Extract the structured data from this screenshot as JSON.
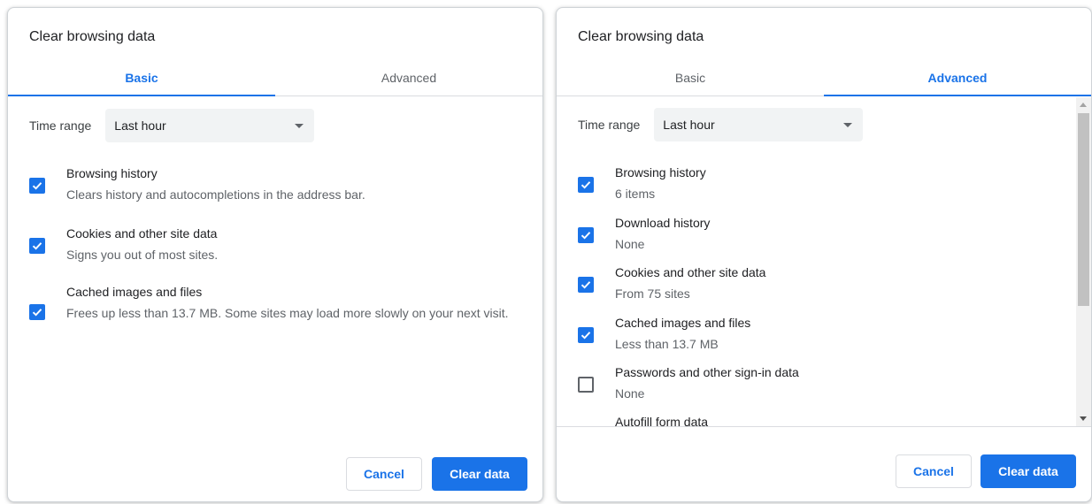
{
  "basic": {
    "title": "Clear browsing data",
    "tabs": [
      {
        "label": "Basic",
        "active": true
      },
      {
        "label": "Advanced",
        "active": false
      }
    ],
    "time_range": {
      "label": "Time range",
      "value": "Last hour"
    },
    "items": [
      {
        "title": "Browsing history",
        "subtitle": "Clears history and autocompletions in the address bar.",
        "checked": true
      },
      {
        "title": "Cookies and other site data",
        "subtitle": "Signs you out of most sites.",
        "checked": true
      },
      {
        "title": "Cached images and files",
        "subtitle": "Frees up less than 13.7 MB. Some sites may load more slowly on your next visit.",
        "checked": true
      }
    ],
    "cancel_label": "Cancel",
    "clear_label": "Clear data"
  },
  "advanced": {
    "title": "Clear browsing data",
    "tabs": [
      {
        "label": "Basic",
        "active": false
      },
      {
        "label": "Advanced",
        "active": true
      }
    ],
    "time_range": {
      "label": "Time range",
      "value": "Last hour"
    },
    "items": [
      {
        "title": "Browsing history",
        "subtitle": "6 items",
        "checked": true
      },
      {
        "title": "Download history",
        "subtitle": "None",
        "checked": true
      },
      {
        "title": "Cookies and other site data",
        "subtitle": "From 75 sites",
        "checked": true
      },
      {
        "title": "Cached images and files",
        "subtitle": "Less than 13.7 MB",
        "checked": true
      },
      {
        "title": "Passwords and other sign-in data",
        "subtitle": "None",
        "checked": false
      },
      {
        "title": "Autofill form data",
        "subtitle": "",
        "checked": false
      }
    ],
    "cancel_label": "Cancel",
    "clear_label": "Clear data"
  },
  "colors": {
    "accent": "#1a73e8",
    "text": "#202124",
    "secondary_text": "#5f6368"
  }
}
